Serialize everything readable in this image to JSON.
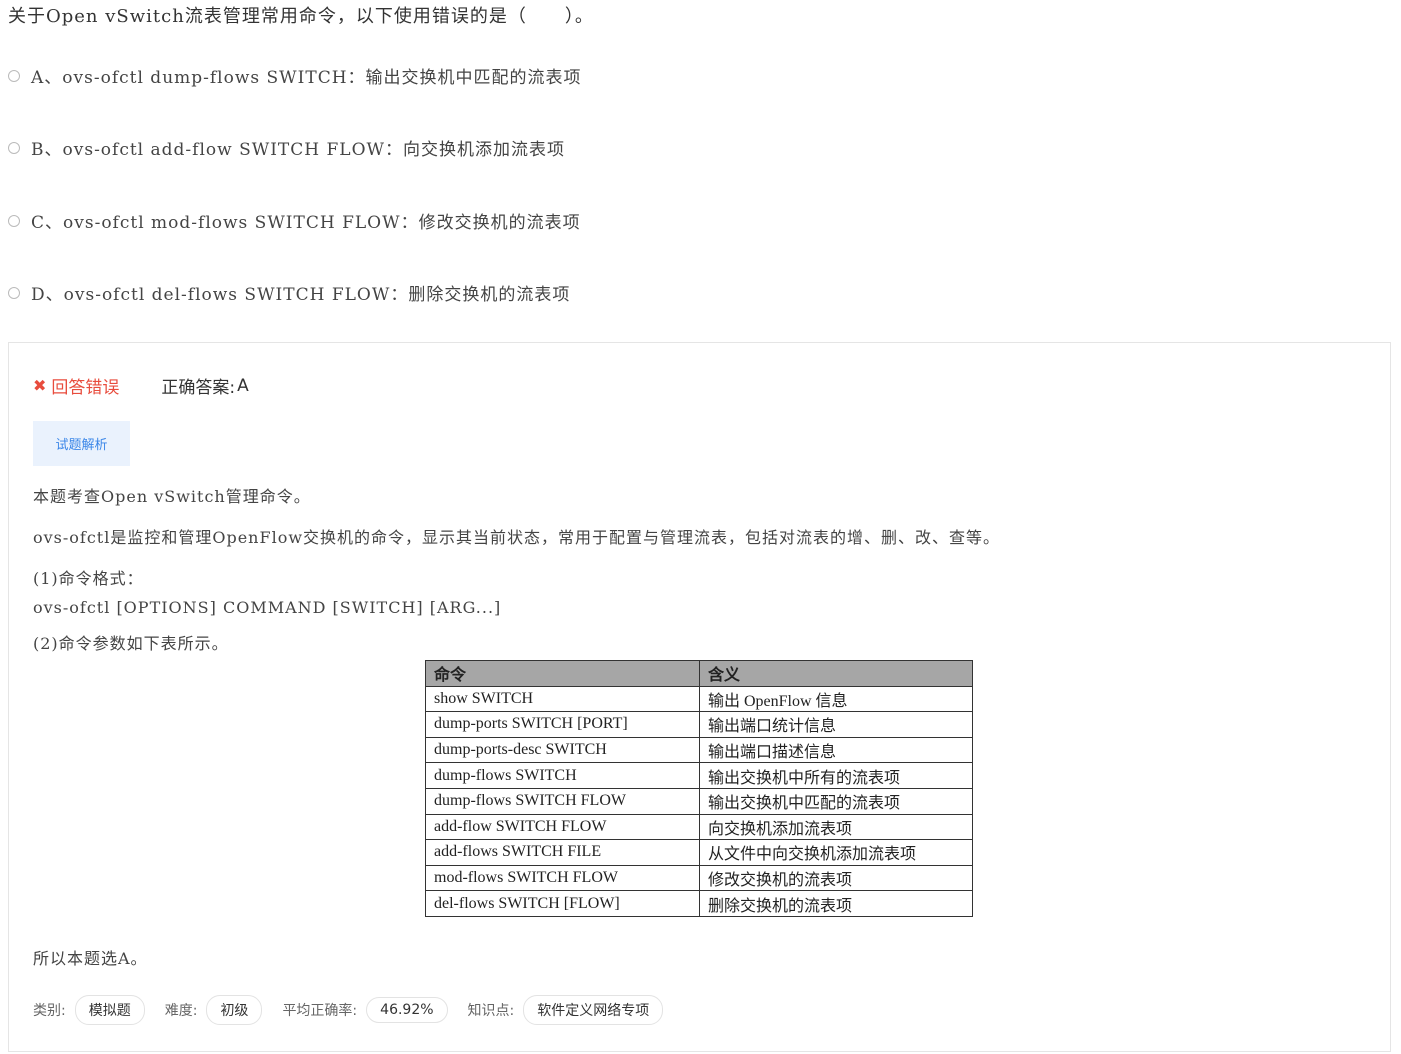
{
  "question": {
    "text": "关于Open vSwitch流表管理常用命令，以下使用错误的是（　　）。"
  },
  "options": [
    {
      "letter": "A、",
      "text": "ovs-ofctl dump-flows SWITCH：输出交换机中匹配的流表项"
    },
    {
      "letter": "B、",
      "text": "ovs-ofctl add-flow SWITCH FLOW：向交换机添加流表项"
    },
    {
      "letter": "C、",
      "text": "ovs-ofctl mod-flows SWITCH FLOW：修改交换机的流表项"
    },
    {
      "letter": "D、",
      "text": "ovs-ofctl del-flows SWITCH FLOW：删除交换机的流表项"
    }
  ],
  "result": {
    "status": "回答错误",
    "correct_label": "正确答案:",
    "correct_answer": "A"
  },
  "analysis_button": "试题解析",
  "explanation": {
    "p1": "本题考查Open vSwitch管理命令。",
    "p2": "ovs-ofctl是监控和管理OpenFlow交换机的命令，显示其当前状态，常用于配置与管理流表，包括对流表的增、删、改、查等。",
    "p3": "(1)命令格式：",
    "p4": "ovs-ofctl [OPTIONS] COMMAND [SWITCH] [ARG...]",
    "p5": "(2)命令参数如下表所示。",
    "conclusion": "所以本题选A。"
  },
  "table": {
    "headers": [
      "命令",
      "含义"
    ],
    "rows": [
      [
        "show SWITCH",
        "输出 OpenFlow 信息"
      ],
      [
        "dump-ports SWITCH [PORT]",
        "输出端口统计信息"
      ],
      [
        "dump-ports-desc SWITCH",
        "输出端口描述信息"
      ],
      [
        "dump-flows SWITCH",
        "输出交换机中所有的流表项"
      ],
      [
        "dump-flows SWITCH FLOW",
        "输出交换机中匹配的流表项"
      ],
      [
        "add-flow SWITCH FLOW",
        "向交换机添加流表项"
      ],
      [
        "add-flows SWITCH FILE",
        "从文件中向交换机添加流表项"
      ],
      [
        "mod-flows SWITCH FLOW",
        "修改交换机的流表项"
      ],
      [
        "del-flows SWITCH [FLOW]",
        "删除交换机的流表项"
      ]
    ]
  },
  "meta": {
    "category_label": "类别:",
    "category": "模拟题",
    "difficulty_label": "难度:",
    "difficulty": "初级",
    "accuracy_label": "平均正确率:",
    "accuracy": "46.92%",
    "knowledge_label": "知识点:",
    "knowledge": "软件定义网络专项"
  },
  "colors": {
    "wrong": "#e84c3d",
    "accent": "#3a86e8",
    "button_bg": "#eaf2fd",
    "table_header": "#a6a6a6"
  }
}
